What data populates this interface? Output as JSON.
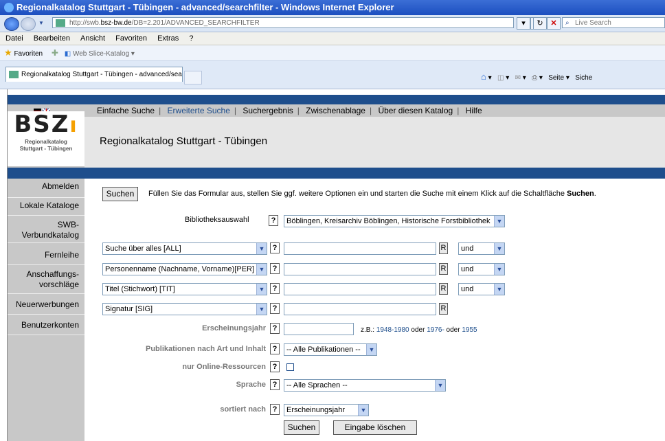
{
  "window": {
    "title": "Regionalkatalog Stuttgart - Tübingen - advanced/searchfilter - Windows Internet Explorer",
    "url_prefix": "http://swb.",
    "url_domain": "bsz-bw.de",
    "url_path": "/DB=2.201/ADVANCED_SEARCHFILTER",
    "live_search": "Live Search",
    "menu": [
      "Datei",
      "Bearbeiten",
      "Ansicht",
      "Favoriten",
      "Extras",
      "?"
    ],
    "favorites_label": "Favoriten",
    "web_slice": "Web Slice-Katalog ▾",
    "tab_title": "Regionalkatalog Stuttgart - Tübingen - advanced/sear...",
    "cmd_seite": "Seite ▾",
    "cmd_sich": "Siche"
  },
  "site": {
    "logo_text": "BSZ",
    "logo_sub1": "Regionalkatalog",
    "logo_sub2": "Stuttgart - Tübingen",
    "title": "Regionalkatalog Stuttgart - Tübingen",
    "nav": [
      {
        "label": "Einfache Suche",
        "active": false
      },
      {
        "label": "Erweiterte Suche",
        "active": true
      },
      {
        "label": "Suchergebnis",
        "active": false
      },
      {
        "label": "Zwischenablage",
        "active": false
      },
      {
        "label": "Über diesen Katalog",
        "active": false
      },
      {
        "label": "Hilfe",
        "active": false
      }
    ],
    "sidebar": [
      "Abmelden",
      "Lokale Kataloge",
      "SWB-\nVerbundkatalog",
      "Fernleihe",
      "Anschaffungs-\nvorschläge",
      "Neuerwerbungen",
      "Benutzerkonten"
    ]
  },
  "form": {
    "search_button": "Suchen",
    "instruction": "Füllen Sie das Formular aus, stellen Sie ggf. weitere Optionen ein und starten die Suche mit einem Klick auf die Schaltfläche ",
    "instruction_bold": "Suchen",
    "instruction_end": ".",
    "library_label": "Bibliotheksauswahl",
    "library_value": "Böblingen, Kreisarchiv Böblingen, Historische Forstbibliothek",
    "help": "?",
    "r": "R",
    "rows": [
      {
        "field": "Suche über alles [ALL]",
        "op": "und"
      },
      {
        "field": "Personenname (Nachname, Vorname)[PER]",
        "op": "und"
      },
      {
        "field": "Titel (Stichwort) [TIT]",
        "op": "und"
      },
      {
        "field": "Signatur [SIG]",
        "op": ""
      }
    ],
    "year_label": "Erscheinungsjahr",
    "year_hint_prefix": "z.B.: ",
    "year_ex1": "1948-1980",
    "year_or1": " oder ",
    "year_ex2": "1976-",
    "year_or2": " oder ",
    "year_ex3": "1955",
    "pub_label": "Publikationen nach Art und Inhalt",
    "pub_value": "-- Alle Publikationen --",
    "online_label": "nur Online-Ressourcen",
    "lang_label": "Sprache",
    "lang_value": "-- Alle Sprachen --",
    "sort_label": "sortiert nach",
    "sort_value": "Erscheinungsjahr",
    "submit": "Suchen",
    "reset": "Eingabe löschen"
  }
}
